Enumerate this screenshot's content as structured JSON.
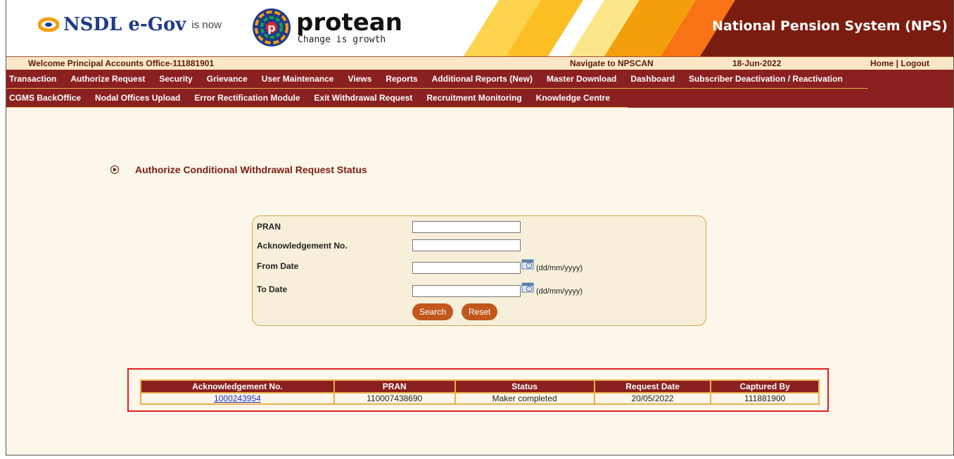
{
  "header": {
    "nsdl_brand": "NSDL e-Gov",
    "is_now": "is now",
    "protean_title": "protean",
    "protean_tagline": "Change is growth",
    "system_title": "National Pension System (NPS)"
  },
  "welcome_bar": {
    "welcome": "Welcome Principal Accounts Office-111881901",
    "navigate": "Navigate to NPSCAN",
    "date": "18-Jun-2022",
    "home_logout": "Home | Logout"
  },
  "menu_row1": [
    "Transaction",
    "Authorize Request",
    "Security",
    "Grievance",
    "User Maintenance",
    "Views",
    "Reports",
    "Additional Reports (New)",
    "Master Download",
    "Dashboard",
    "Subscriber Deactivation / Reactivation"
  ],
  "menu_row2": [
    "CGMS BackOffice",
    "Nodal Offices Upload",
    "Error Rectification Module",
    "Exit Withdrawal Request",
    "Recruitment Monitoring",
    "Knowledge Centre"
  ],
  "page_title": "Authorize Conditional Withdrawal Request Status",
  "form": {
    "pran_label": "PRAN",
    "ack_label": "Acknowledgement No.",
    "from_label": "From Date",
    "to_label": "To Date",
    "date_format": "(dd/mm/yyyy)",
    "pran_value": "",
    "ack_value": "",
    "from_value": "",
    "to_value": "",
    "search_label": "Search",
    "reset_label": "Reset"
  },
  "results": {
    "columns": [
      "Acknowledgement No.",
      "PRAN",
      "Status",
      "Request Date",
      "Captured By"
    ],
    "rows": [
      [
        "1000243954",
        "110007438690",
        "Maker completed",
        "20/05/2022",
        "111881900"
      ]
    ]
  },
  "colors": {
    "menu_bg": "#8b2020",
    "accent_gold": "#e8b04a",
    "button": "#c2571c",
    "highlight_border": "#e02020"
  }
}
